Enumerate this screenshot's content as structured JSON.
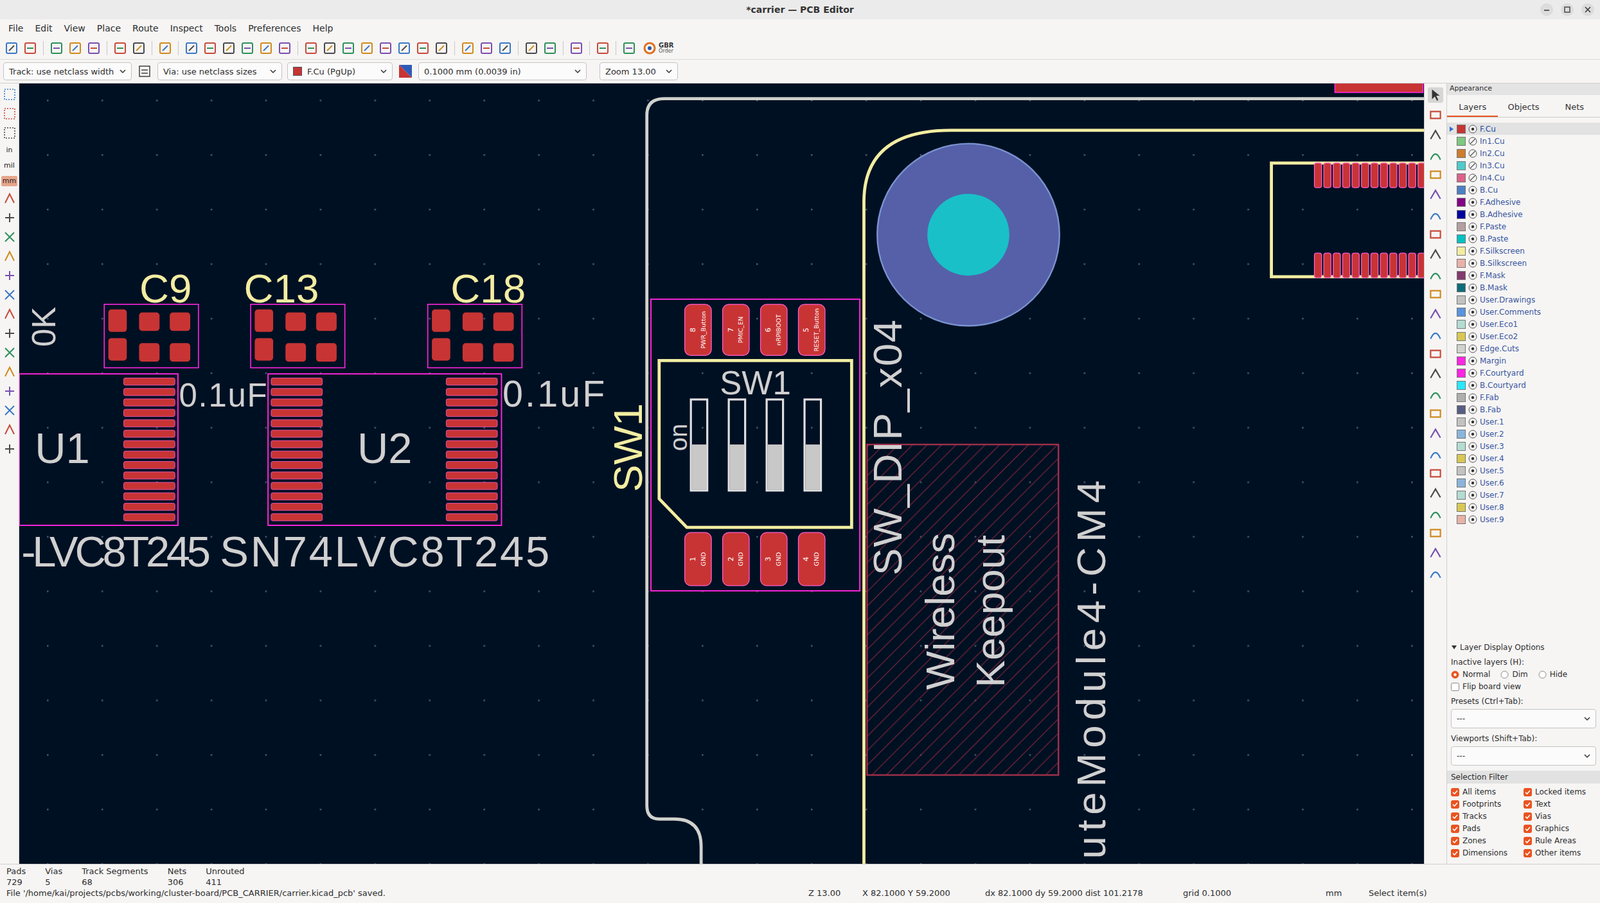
{
  "window": {
    "title": "*carrier — PCB Editor"
  },
  "menu": [
    "File",
    "Edit",
    "View",
    "Place",
    "Route",
    "Inspect",
    "Tools",
    "Preferences",
    "Help"
  ],
  "toolbar": {
    "gbr": "GBR",
    "order": "Order"
  },
  "options_bar": {
    "track": "Track: use netclass width",
    "via": "Via: use netclass sizes",
    "layer": "F.Cu (PgUp)",
    "layer_color": "#c83434",
    "grid": "0.1000 mm (0.0039 in)",
    "zoom": "Zoom 13.00"
  },
  "units": [
    {
      "label": "in",
      "selected": false
    },
    {
      "label": "mil",
      "selected": false
    },
    {
      "label": "mm",
      "selected": true
    }
  ],
  "canvas": {
    "caps": [
      "C9",
      "C13",
      "C18"
    ],
    "resistor_value": "0K",
    "cap_values": [
      "0.1uF",
      "0.1uF"
    ],
    "ics": [
      {
        "ref": "U1",
        "value": "-LVC8T245"
      },
      {
        "ref": "U2",
        "value": "SN74LVC8T245"
      }
    ],
    "switch": {
      "ref": "SW1",
      "body_ref": "SW1",
      "on_label": "on",
      "value": "SW_DIP_x04",
      "top_pads": [
        {
          "num": "8",
          "net": "PWR_Button"
        },
        {
          "num": "7",
          "net": "PMIC_EN"
        },
        {
          "num": "6",
          "net": "nRPIBOOT"
        },
        {
          "num": "5",
          "net": "RESET_Button"
        }
      ],
      "bottom_pads": [
        {
          "num": "1",
          "net": "GND"
        },
        {
          "num": "2",
          "net": "GND"
        },
        {
          "num": "3",
          "net": "GND"
        },
        {
          "num": "4",
          "net": "GND"
        }
      ],
      "levers": [
        {
          "on": false
        },
        {
          "on": false
        },
        {
          "on": false
        },
        {
          "on": false
        }
      ]
    },
    "keepout": [
      "Wireless",
      "Keepout"
    ],
    "module": "uteModule4-CM4"
  },
  "appearance": {
    "title": "Appearance",
    "tabs": [
      {
        "label": "Layers",
        "selected": true
      },
      {
        "label": "Objects",
        "selected": false
      },
      {
        "label": "Nets",
        "selected": false
      }
    ],
    "layers": [
      {
        "name": "F.Cu",
        "color": "#c83434",
        "visible": true,
        "selected": true
      },
      {
        "name": "In1.Cu",
        "color": "#7fc87f",
        "visible": false,
        "selected": false
      },
      {
        "name": "In2.Cu",
        "color": "#ce7d2c",
        "visible": false,
        "selected": false
      },
      {
        "name": "In3.Cu",
        "color": "#4fcbcb",
        "visible": false,
        "selected": false
      },
      {
        "name": "In4.Cu",
        "color": "#db628b",
        "visible": false,
        "selected": false
      },
      {
        "name": "B.Cu",
        "color": "#4d7fc4",
        "visible": true,
        "selected": false
      },
      {
        "name": "F.Adhesive",
        "color": "#840084",
        "visible": true,
        "selected": false
      },
      {
        "name": "B.Adhesive",
        "color": "#0000a0",
        "visible": true,
        "selected": false
      },
      {
        "name": "F.Paste",
        "color": "#b4a0a0",
        "visible": true,
        "selected": false
      },
      {
        "name": "B.Paste",
        "color": "#00c2c2",
        "visible": true,
        "selected": false
      },
      {
        "name": "F.Silkscreen",
        "color": "#f2eda1",
        "visible": true,
        "selected": false
      },
      {
        "name": "B.Silkscreen",
        "color": "#e8b2a7",
        "visible": true,
        "selected": false
      },
      {
        "name": "F.Mask",
        "color": "#843a6c",
        "visible": true,
        "selected": false
      },
      {
        "name": "B.Mask",
        "color": "#0d6e7a",
        "visible": true,
        "selected": false
      },
      {
        "name": "User.Drawings",
        "color": "#c2c2c2",
        "visible": true,
        "selected": false
      },
      {
        "name": "User.Comments",
        "color": "#5994dc",
        "visible": true,
        "selected": false
      },
      {
        "name": "User.Eco1",
        "color": "#b4dbd2",
        "visible": true,
        "selected": false
      },
      {
        "name": "User.Eco2",
        "color": "#d8c852",
        "visible": true,
        "selected": false
      },
      {
        "name": "Edge.Cuts",
        "color": "#d0d2cd",
        "visible": true,
        "selected": false
      },
      {
        "name": "Margin",
        "color": "#ff26e2",
        "visible": true,
        "selected": false
      },
      {
        "name": "F.Courtyard",
        "color": "#ff26e2",
        "visible": true,
        "selected": false
      },
      {
        "name": "B.Courtyard",
        "color": "#26e9ff",
        "visible": true,
        "selected": false
      },
      {
        "name": "F.Fab",
        "color": "#afafaf",
        "visible": true,
        "selected": false
      },
      {
        "name": "B.Fab",
        "color": "#585d84",
        "visible": true,
        "selected": false
      },
      {
        "name": "User.1",
        "color": "#c2c2c2",
        "visible": true,
        "selected": false
      },
      {
        "name": "User.2",
        "color": "#89b5db",
        "visible": true,
        "selected": false
      },
      {
        "name": "User.3",
        "color": "#b4dbd2",
        "visible": true,
        "selected": false
      },
      {
        "name": "User.4",
        "color": "#d8c852",
        "visible": true,
        "selected": false
      },
      {
        "name": "User.5",
        "color": "#c2c2c2",
        "visible": true,
        "selected": false
      },
      {
        "name": "User.6",
        "color": "#89b5db",
        "visible": true,
        "selected": false
      },
      {
        "name": "User.7",
        "color": "#b4dbd2",
        "visible": true,
        "selected": false
      },
      {
        "name": "User.8",
        "color": "#d8c852",
        "visible": true,
        "selected": false
      },
      {
        "name": "User.9",
        "color": "#e8b2a7",
        "visible": true,
        "selected": false
      }
    ],
    "display_options": {
      "title": "Layer Display Options",
      "inactive_label": "Inactive layers (H):",
      "modes": [
        {
          "label": "Normal",
          "selected": true
        },
        {
          "label": "Dim",
          "selected": false
        },
        {
          "label": "Hide",
          "selected": false
        }
      ],
      "flip": {
        "label": "Flip board view",
        "checked": false
      }
    },
    "presets": {
      "label": "Presets (Ctrl+Tab):",
      "value": "---"
    },
    "viewports": {
      "label": "Viewports (Shift+Tab):",
      "value": "---"
    },
    "selection_filter": {
      "title": "Selection Filter",
      "items": [
        {
          "label": "All items",
          "checked": true
        },
        {
          "label": "Locked items",
          "checked": true
        },
        {
          "label": "Footprints",
          "checked": true
        },
        {
          "label": "Text",
          "checked": true
        },
        {
          "label": "Tracks",
          "checked": true
        },
        {
          "label": "Vias",
          "checked": true
        },
        {
          "label": "Pads",
          "checked": true
        },
        {
          "label": "Graphics",
          "checked": true
        },
        {
          "label": "Zones",
          "checked": true
        },
        {
          "label": "Rule Areas",
          "checked": true
        },
        {
          "label": "Dimensions",
          "checked": true
        },
        {
          "label": "Other items",
          "checked": true
        }
      ]
    }
  },
  "stats": [
    {
      "label": "Pads",
      "value": "729"
    },
    {
      "label": "Vias",
      "value": "5"
    },
    {
      "label": "Track Segments",
      "value": "68"
    },
    {
      "label": "Nets",
      "value": "306"
    },
    {
      "label": "Unrouted",
      "value": "411"
    }
  ],
  "status_bar": {
    "message": "File '/home/kai/projects/pcbs/working/cluster-board/PCB_CARRIER/carrier.kicad_pcb' saved.",
    "zoom": "Z 13.00",
    "cursor": "X 82.1000 Y 59.2000",
    "delta": "dx 82.1000 dy 59.2000 dist 101.2178",
    "grid": "grid 0.1000",
    "units": "mm",
    "mode": "Select item(s)"
  }
}
